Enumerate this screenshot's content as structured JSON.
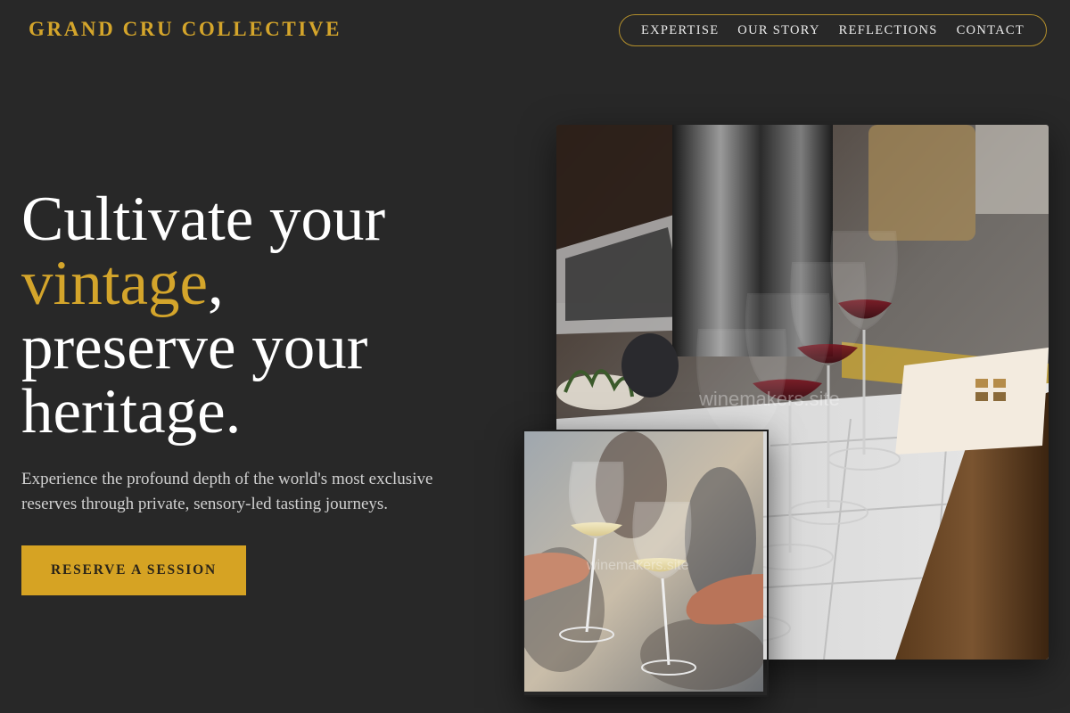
{
  "brand": {
    "name": "GRAND CRU COLLECTIVE"
  },
  "nav": {
    "items": [
      {
        "label": "EXPERTISE"
      },
      {
        "label": "OUR STORY"
      },
      {
        "label": "REFLECTIONS"
      },
      {
        "label": "CONTACT"
      }
    ]
  },
  "hero": {
    "headline_line1": "Cultivate your",
    "headline_accent": "vintage",
    "headline_comma": ",",
    "headline_line3": "preserve your",
    "headline_line4": "heritage.",
    "subtitle": "Experience the profound depth of the world's most exclusive reserves through private, sensory-led tasting journeys.",
    "cta_label": "RESERVE A SESSION"
  },
  "images": {
    "main": {
      "watermark": "winemakers.site"
    },
    "secondary": {
      "watermark": "winemakers.site"
    }
  },
  "colors": {
    "background": "#282828",
    "accent": "#d4a52b",
    "cta_background": "#d6a323"
  }
}
